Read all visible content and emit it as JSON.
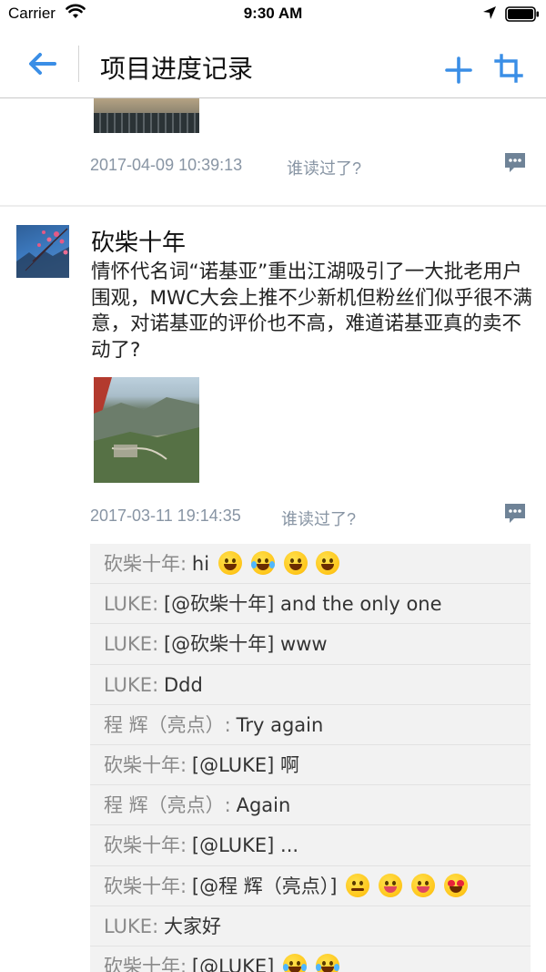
{
  "status_bar": {
    "carrier": "Carrier",
    "time": "9:30 AM"
  },
  "nav": {
    "title": "项目进度记录"
  },
  "colors": {
    "accent": "#3a8ee6",
    "meta": "#8895a4",
    "comment_bg": "#f2f2f2"
  },
  "icons": [
    "wifi-icon",
    "location-arrow-icon",
    "battery-icon",
    "back-arrow-icon",
    "plus-icon",
    "crop-icon",
    "comment-icon"
  ],
  "posts": [
    {
      "timestamp": "2017-04-09 10:39:13",
      "read_prompt": "谁读过了?"
    },
    {
      "author": "砍柴十年",
      "text": "情怀代名词“诺基亚”重出江湖吸引了一大批老用户围观，MWC大会上推不少新机但粉丝们似乎很不满意，对诺基亚的评价也不高，难道诺基亚真的卖不动了?",
      "timestamp": "2017-03-11 19:14:35",
      "read_prompt": "谁读过了?",
      "comments": [
        {
          "name": "砍柴十年:",
          "text": "hi"
        },
        {
          "name": "LUKE:",
          "text": "[@砍柴十年] and the only one"
        },
        {
          "name": "LUKE:",
          "text": "[@砍柴十年] www"
        },
        {
          "name": "LUKE:",
          "text": "Ddd"
        },
        {
          "name": "程 辉（亮点）:",
          "text": "Try again"
        },
        {
          "name": "砍柴十年:",
          "text": "[@LUKE] 啊"
        },
        {
          "name": "程 辉（亮点）:",
          "text": "Again"
        },
        {
          "name": "砍柴十年:",
          "text": "[@LUKE] ..."
        },
        {
          "name": "砍柴十年:",
          "text": "[@程 辉（亮点）]"
        },
        {
          "name": "LUKE:",
          "text": "大家好"
        },
        {
          "name": "砍柴十年:",
          "text": "[@LUKE]"
        }
      ]
    }
  ]
}
